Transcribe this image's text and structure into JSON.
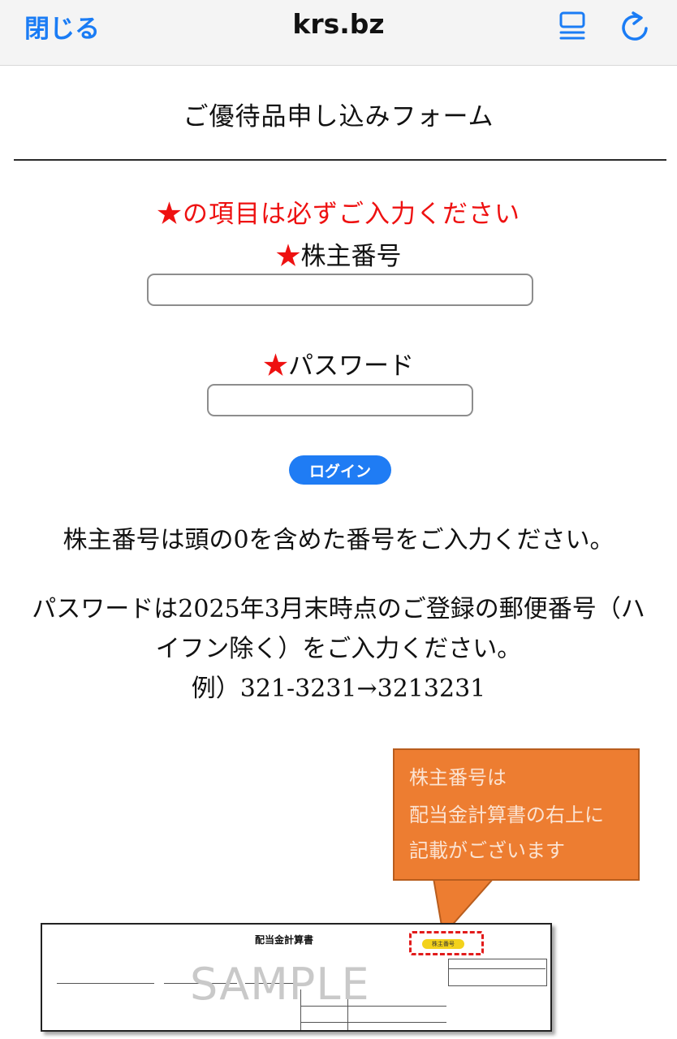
{
  "browser": {
    "close_label": "閉じる",
    "site_title": "krs.bz",
    "icons": [
      "reader-list-icon",
      "reload-icon"
    ],
    "accent_color": "#1a7cf5"
  },
  "form": {
    "title": "ご優待品申し込みフォーム",
    "required_note": "★の項目は必ずご入力ください",
    "required_mark": "★",
    "shareholder_label": "株主番号",
    "shareholder_value": "",
    "password_label": "パスワード",
    "password_value": "",
    "login_label": "ログイン",
    "required_color": "#ee1111"
  },
  "notes": {
    "line1": "株主番号は頭の0を含めた番号をご入力ください。",
    "line2a": "パスワードは2025年3月末時点のご登録の郵便番号（ハ",
    "line2b": "イフン除く）をご入力ください。",
    "line3": "例）321-3231→3213231"
  },
  "callout": {
    "line1": "株主番号は",
    "line2": "配当金計算書の右上に",
    "line3": "記載がございます",
    "color": "#ed7d31"
  },
  "sample_doc": {
    "title": "配当金計算書",
    "watermark": "SAMPLE",
    "badge": "株主番号"
  }
}
